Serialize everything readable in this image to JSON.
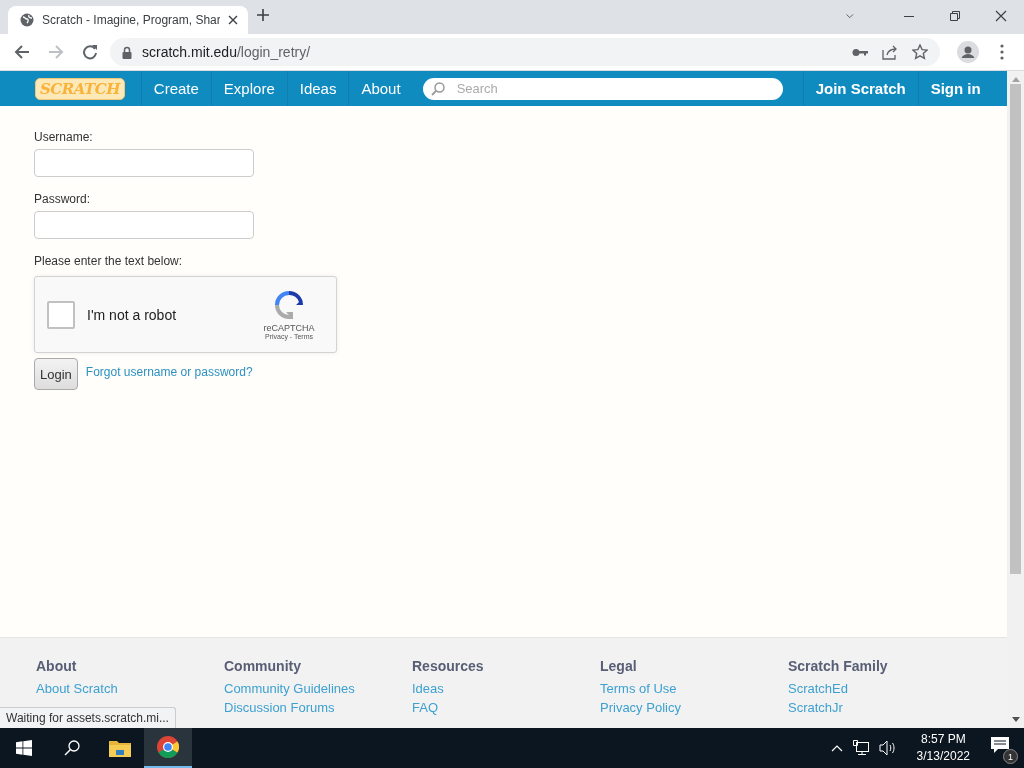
{
  "browser": {
    "tabs": [
      {
        "title": "Scratch - Imagine, Program, Shar",
        "selected": true
      }
    ],
    "url_host": "scratch.mit.edu",
    "url_path": "/login_retry/"
  },
  "nav": {
    "logo": "SCRATCH",
    "links": [
      "Create",
      "Explore",
      "Ideas",
      "About"
    ],
    "search": {
      "placeholder": "Search"
    },
    "actions": [
      "Join Scratch",
      "Sign in"
    ]
  },
  "form": {
    "fields": [
      {
        "label": "Username:"
      },
      {
        "label": "Password:"
      }
    ],
    "captcha_prompt": "Please enter the text below:",
    "captcha": {
      "label": "I'm not a robot",
      "checked": false,
      "brand": "reCAPTCHA",
      "links": "Privacy - Terms"
    },
    "login_button": "Login",
    "forgot_link": "Forgot username or password?"
  },
  "footer": {
    "columns": [
      {
        "heading": "About",
        "links": [
          "About Scratch"
        ]
      },
      {
        "heading": "Community",
        "links": [
          "Community Guidelines",
          "Discussion Forums"
        ]
      },
      {
        "heading": "Resources",
        "links": [
          "Ideas",
          "FAQ"
        ]
      },
      {
        "heading": "Legal",
        "links": [
          "Terms of Use",
          "Privacy Policy"
        ]
      },
      {
        "heading": "Scratch Family",
        "links": [
          "ScratchEd",
          "ScratchJr"
        ]
      }
    ]
  },
  "status_bubble": "Waiting for assets.scratch.mi...",
  "taskbar": {
    "time": "8:57 PM",
    "date": "3/13/2022",
    "notifications": "1"
  }
}
